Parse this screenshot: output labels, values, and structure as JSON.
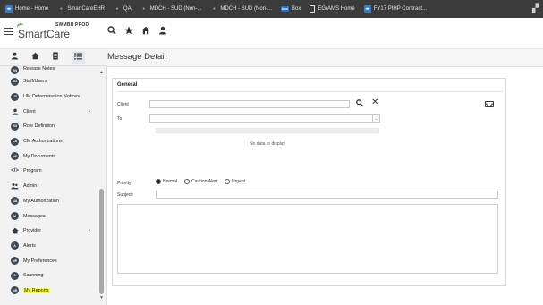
{
  "browser": {
    "bookmarks": [
      {
        "label": "Home - Home",
        "icon": "arrows-icon"
      },
      {
        "label": "SmartCareEHR",
        "icon": "dot-icon"
      },
      {
        "label": "QA",
        "icon": "dot-icon"
      },
      {
        "label": "MDCH - SUD (Non-...",
        "icon": "dot-icon"
      },
      {
        "label": "MDCH - SUD (Non-...",
        "icon": "dot-icon"
      },
      {
        "label": "Box",
        "icon": "box-icon"
      },
      {
        "label": "EGrAMS Home",
        "icon": "document-icon"
      },
      {
        "label": "FY17 PIHP Contract...",
        "icon": "arrows-icon"
      }
    ]
  },
  "app": {
    "environment": "SWMBH PROD",
    "logo_text": "SmartCare"
  },
  "page": {
    "title": "Message Detail"
  },
  "sidebar": {
    "items": [
      {
        "label": "Release Notes",
        "badge": "RN",
        "type": "badge",
        "chevron": false
      },
      {
        "label": "Staff/Users",
        "badge": "SU",
        "type": "badge",
        "chevron": false
      },
      {
        "label": "UM Determination Notices",
        "badge": "UD",
        "type": "badge",
        "chevron": false
      },
      {
        "label": "Client",
        "badge": "",
        "type": "person",
        "chevron": true
      },
      {
        "label": "Role Definition",
        "badge": "RD",
        "type": "badge",
        "chevron": false
      },
      {
        "label": "CM Authorizations",
        "badge": "CA",
        "type": "badge",
        "chevron": false
      },
      {
        "label": "My Documents",
        "badge": "MD",
        "type": "badge",
        "chevron": false
      },
      {
        "label": "Program",
        "badge": "",
        "type": "code",
        "chevron": false
      },
      {
        "label": "Admin",
        "badge": "",
        "type": "people",
        "chevron": false
      },
      {
        "label": "My Authorization",
        "badge": "MA",
        "type": "badge",
        "chevron": false
      },
      {
        "label": "Messages",
        "badge": "M",
        "type": "badge",
        "chevron": false
      },
      {
        "label": "Provider",
        "badge": "",
        "type": "building",
        "chevron": true
      },
      {
        "label": "Alerts",
        "badge": "A",
        "type": "badge",
        "chevron": false
      },
      {
        "label": "My Preferences",
        "badge": "MP",
        "type": "badge",
        "chevron": false
      },
      {
        "label": "Scanning",
        "badge": "S",
        "type": "badge",
        "chevron": false
      },
      {
        "label": "My Reports",
        "badge": "MR",
        "type": "badge",
        "chevron": false,
        "highlighted": true
      }
    ]
  },
  "form": {
    "section_title": "General",
    "client_label": "Client",
    "to_label": "To",
    "no_data": "No data to display",
    "priority_label": "Priority",
    "priority_options": [
      "Normal",
      "Caution/Alert",
      "Urgent"
    ],
    "priority_selected": "Normal",
    "subject_label": "Subject:"
  },
  "colors": {
    "bookmark_bar": "#3b3b3b",
    "highlight": "#f5ff3a",
    "badge": "#3d4a55"
  }
}
